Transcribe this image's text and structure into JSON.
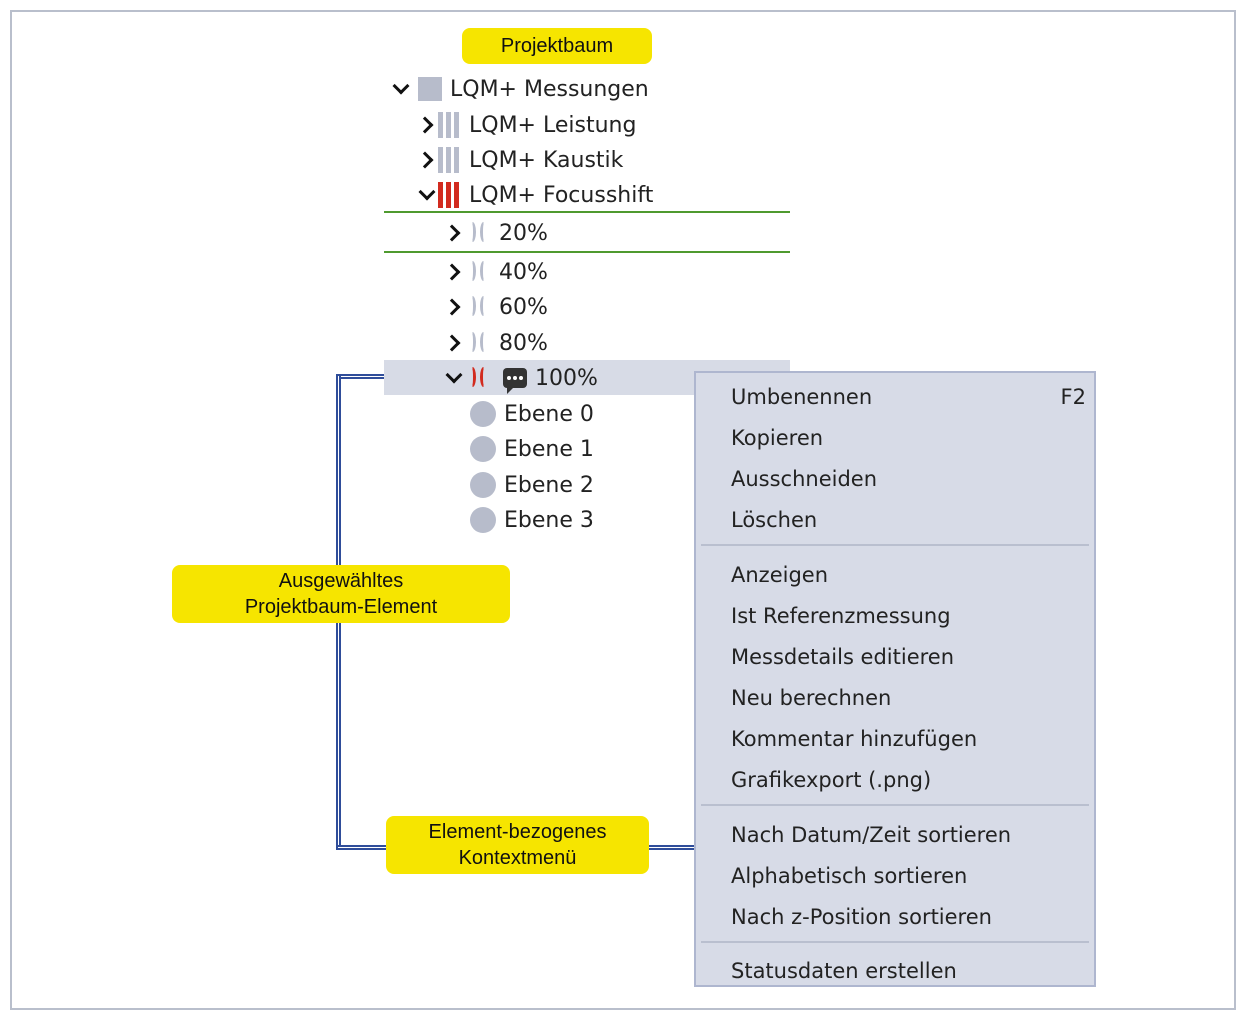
{
  "callouts": {
    "tree": "Projektbaum",
    "selected_line1": "Ausgewähltes",
    "selected_line2": "Projektbaum-Element",
    "context_line1": "Element-bezogenes",
    "context_line2": "Kontextmenü"
  },
  "tree": {
    "root": "LQM+ Messungen",
    "children": [
      {
        "label": "LQM+ Leistung"
      },
      {
        "label": "LQM+ Kaustik"
      },
      {
        "label": "LQM+ Focusshift"
      }
    ],
    "focusshift_items": [
      {
        "label": "20%"
      },
      {
        "label": "40%"
      },
      {
        "label": "60%"
      },
      {
        "label": "80%"
      },
      {
        "label": "100%"
      }
    ],
    "levels": [
      {
        "label": "Ebene 0"
      },
      {
        "label": "Ebene 1"
      },
      {
        "label": "Ebene 2"
      },
      {
        "label": "Ebene 3"
      }
    ]
  },
  "context_menu": {
    "rename": "Umbenennen",
    "rename_shortcut": "F2",
    "copy": "Kopieren",
    "cut": "Ausschneiden",
    "delete": "Löschen",
    "show": "Anzeigen",
    "reference": "Ist Referenzmessung",
    "edit_details": "Messdetails editieren",
    "recalc": "Neu berechnen",
    "add_comment": "Kommentar hinzufügen",
    "export_png": "Grafikexport (.png)",
    "sort_date": "Nach Datum/Zeit sortieren",
    "sort_alpha": "Alphabetisch sortieren",
    "sort_z": "Nach z-Position sortieren",
    "status": "Statusdaten erstellen"
  },
  "colors": {
    "callout": "#f6e500",
    "selection": "#d7dbe6",
    "menu_bg": "#d7dbe7",
    "accent_red": "#d22b1f",
    "hover_line": "#4f9a2f",
    "connector": "#2f4d9a"
  }
}
